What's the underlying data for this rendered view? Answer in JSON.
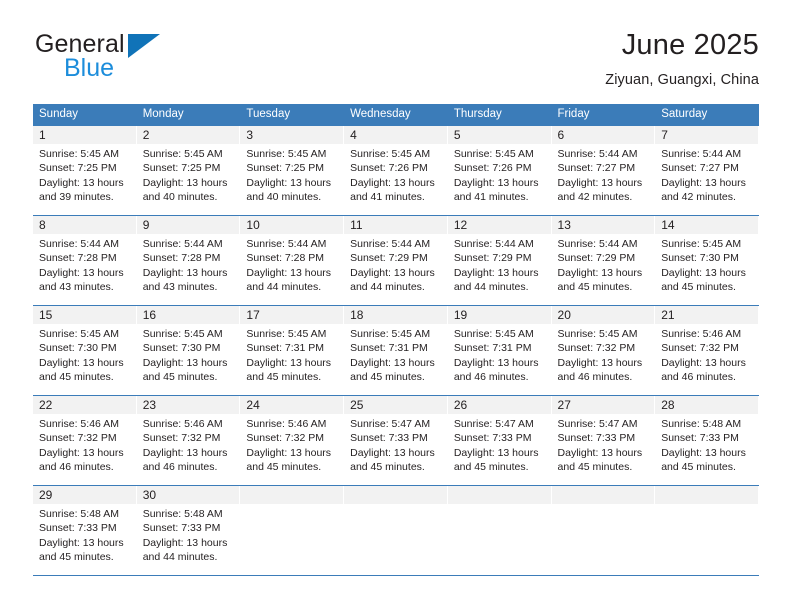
{
  "brand": {
    "name_part1": "General",
    "name_part2": "Blue",
    "triangle_icon": "triangle-icon",
    "colors": {
      "dark": "#231f20",
      "blue": "#1c8ddb",
      "triangle": "#1073b8"
    }
  },
  "header": {
    "title": "June 2025",
    "subtitle": "Ziyuan, Guangxi, China"
  },
  "theme": {
    "header_bg": "#3b7cb9",
    "header_text": "#ffffff",
    "daynum_bg": "#f2f2f2",
    "rule": "#3b7cb9"
  },
  "weekdays": [
    "Sunday",
    "Monday",
    "Tuesday",
    "Wednesday",
    "Thursday",
    "Friday",
    "Saturday"
  ],
  "weeks": [
    [
      {
        "day": "1",
        "sunrise": "Sunrise: 5:45 AM",
        "sunset": "Sunset: 7:25 PM",
        "daylight1": "Daylight: 13 hours",
        "daylight2": "and 39 minutes."
      },
      {
        "day": "2",
        "sunrise": "Sunrise: 5:45 AM",
        "sunset": "Sunset: 7:25 PM",
        "daylight1": "Daylight: 13 hours",
        "daylight2": "and 40 minutes."
      },
      {
        "day": "3",
        "sunrise": "Sunrise: 5:45 AM",
        "sunset": "Sunset: 7:25 PM",
        "daylight1": "Daylight: 13 hours",
        "daylight2": "and 40 minutes."
      },
      {
        "day": "4",
        "sunrise": "Sunrise: 5:45 AM",
        "sunset": "Sunset: 7:26 PM",
        "daylight1": "Daylight: 13 hours",
        "daylight2": "and 41 minutes."
      },
      {
        "day": "5",
        "sunrise": "Sunrise: 5:45 AM",
        "sunset": "Sunset: 7:26 PM",
        "daylight1": "Daylight: 13 hours",
        "daylight2": "and 41 minutes."
      },
      {
        "day": "6",
        "sunrise": "Sunrise: 5:44 AM",
        "sunset": "Sunset: 7:27 PM",
        "daylight1": "Daylight: 13 hours",
        "daylight2": "and 42 minutes."
      },
      {
        "day": "7",
        "sunrise": "Sunrise: 5:44 AM",
        "sunset": "Sunset: 7:27 PM",
        "daylight1": "Daylight: 13 hours",
        "daylight2": "and 42 minutes."
      }
    ],
    [
      {
        "day": "8",
        "sunrise": "Sunrise: 5:44 AM",
        "sunset": "Sunset: 7:28 PM",
        "daylight1": "Daylight: 13 hours",
        "daylight2": "and 43 minutes."
      },
      {
        "day": "9",
        "sunrise": "Sunrise: 5:44 AM",
        "sunset": "Sunset: 7:28 PM",
        "daylight1": "Daylight: 13 hours",
        "daylight2": "and 43 minutes."
      },
      {
        "day": "10",
        "sunrise": "Sunrise: 5:44 AM",
        "sunset": "Sunset: 7:28 PM",
        "daylight1": "Daylight: 13 hours",
        "daylight2": "and 44 minutes."
      },
      {
        "day": "11",
        "sunrise": "Sunrise: 5:44 AM",
        "sunset": "Sunset: 7:29 PM",
        "daylight1": "Daylight: 13 hours",
        "daylight2": "and 44 minutes."
      },
      {
        "day": "12",
        "sunrise": "Sunrise: 5:44 AM",
        "sunset": "Sunset: 7:29 PM",
        "daylight1": "Daylight: 13 hours",
        "daylight2": "and 44 minutes."
      },
      {
        "day": "13",
        "sunrise": "Sunrise: 5:44 AM",
        "sunset": "Sunset: 7:29 PM",
        "daylight1": "Daylight: 13 hours",
        "daylight2": "and 45 minutes."
      },
      {
        "day": "14",
        "sunrise": "Sunrise: 5:45 AM",
        "sunset": "Sunset: 7:30 PM",
        "daylight1": "Daylight: 13 hours",
        "daylight2": "and 45 minutes."
      }
    ],
    [
      {
        "day": "15",
        "sunrise": "Sunrise: 5:45 AM",
        "sunset": "Sunset: 7:30 PM",
        "daylight1": "Daylight: 13 hours",
        "daylight2": "and 45 minutes."
      },
      {
        "day": "16",
        "sunrise": "Sunrise: 5:45 AM",
        "sunset": "Sunset: 7:30 PM",
        "daylight1": "Daylight: 13 hours",
        "daylight2": "and 45 minutes."
      },
      {
        "day": "17",
        "sunrise": "Sunrise: 5:45 AM",
        "sunset": "Sunset: 7:31 PM",
        "daylight1": "Daylight: 13 hours",
        "daylight2": "and 45 minutes."
      },
      {
        "day": "18",
        "sunrise": "Sunrise: 5:45 AM",
        "sunset": "Sunset: 7:31 PM",
        "daylight1": "Daylight: 13 hours",
        "daylight2": "and 45 minutes."
      },
      {
        "day": "19",
        "sunrise": "Sunrise: 5:45 AM",
        "sunset": "Sunset: 7:31 PM",
        "daylight1": "Daylight: 13 hours",
        "daylight2": "and 46 minutes."
      },
      {
        "day": "20",
        "sunrise": "Sunrise: 5:45 AM",
        "sunset": "Sunset: 7:32 PM",
        "daylight1": "Daylight: 13 hours",
        "daylight2": "and 46 minutes."
      },
      {
        "day": "21",
        "sunrise": "Sunrise: 5:46 AM",
        "sunset": "Sunset: 7:32 PM",
        "daylight1": "Daylight: 13 hours",
        "daylight2": "and 46 minutes."
      }
    ],
    [
      {
        "day": "22",
        "sunrise": "Sunrise: 5:46 AM",
        "sunset": "Sunset: 7:32 PM",
        "daylight1": "Daylight: 13 hours",
        "daylight2": "and 46 minutes."
      },
      {
        "day": "23",
        "sunrise": "Sunrise: 5:46 AM",
        "sunset": "Sunset: 7:32 PM",
        "daylight1": "Daylight: 13 hours",
        "daylight2": "and 46 minutes."
      },
      {
        "day": "24",
        "sunrise": "Sunrise: 5:46 AM",
        "sunset": "Sunset: 7:32 PM",
        "daylight1": "Daylight: 13 hours",
        "daylight2": "and 45 minutes."
      },
      {
        "day": "25",
        "sunrise": "Sunrise: 5:47 AM",
        "sunset": "Sunset: 7:33 PM",
        "daylight1": "Daylight: 13 hours",
        "daylight2": "and 45 minutes."
      },
      {
        "day": "26",
        "sunrise": "Sunrise: 5:47 AM",
        "sunset": "Sunset: 7:33 PM",
        "daylight1": "Daylight: 13 hours",
        "daylight2": "and 45 minutes."
      },
      {
        "day": "27",
        "sunrise": "Sunrise: 5:47 AM",
        "sunset": "Sunset: 7:33 PM",
        "daylight1": "Daylight: 13 hours",
        "daylight2": "and 45 minutes."
      },
      {
        "day": "28",
        "sunrise": "Sunrise: 5:48 AM",
        "sunset": "Sunset: 7:33 PM",
        "daylight1": "Daylight: 13 hours",
        "daylight2": "and 45 minutes."
      }
    ],
    [
      {
        "day": "29",
        "sunrise": "Sunrise: 5:48 AM",
        "sunset": "Sunset: 7:33 PM",
        "daylight1": "Daylight: 13 hours",
        "daylight2": "and 45 minutes."
      },
      {
        "day": "30",
        "sunrise": "Sunrise: 5:48 AM",
        "sunset": "Sunset: 7:33 PM",
        "daylight1": "Daylight: 13 hours",
        "daylight2": "and 44 minutes."
      },
      {
        "day": "",
        "sunrise": "",
        "sunset": "",
        "daylight1": "",
        "daylight2": ""
      },
      {
        "day": "",
        "sunrise": "",
        "sunset": "",
        "daylight1": "",
        "daylight2": ""
      },
      {
        "day": "",
        "sunrise": "",
        "sunset": "",
        "daylight1": "",
        "daylight2": ""
      },
      {
        "day": "",
        "sunrise": "",
        "sunset": "",
        "daylight1": "",
        "daylight2": ""
      },
      {
        "day": "",
        "sunrise": "",
        "sunset": "",
        "daylight1": "",
        "daylight2": ""
      }
    ]
  ]
}
